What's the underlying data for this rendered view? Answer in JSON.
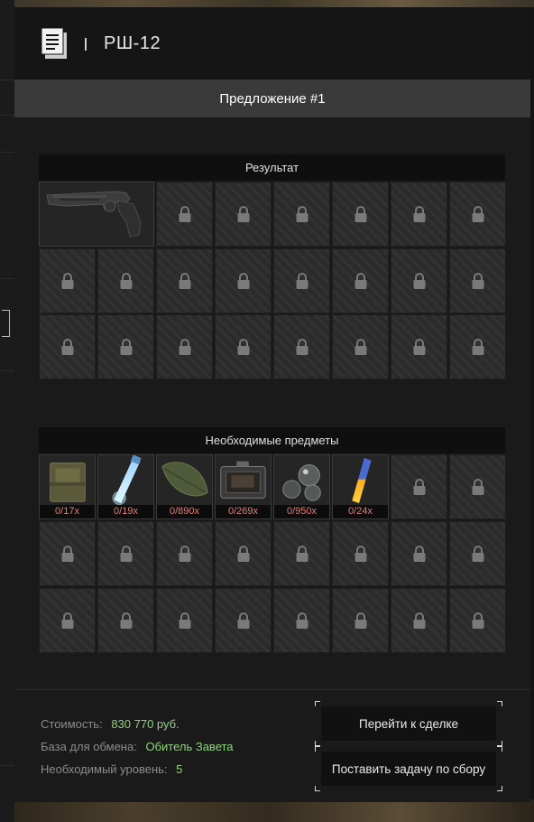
{
  "header": {
    "title": "РШ-12",
    "icon": "document-icon"
  },
  "offer": {
    "label": "Предложение #1"
  },
  "result": {
    "heading": "Результат",
    "item": {
      "name": "rsh-12-revolver",
      "icon": "revolver-icon"
    }
  },
  "required": {
    "heading": "Необходимые предметы",
    "items": [
      {
        "count": "0/17x",
        "icon": "ammo-box-icon"
      },
      {
        "count": "0/19x",
        "icon": "glowstick-blue-icon"
      },
      {
        "count": "0/890x",
        "icon": "leaf-icon"
      },
      {
        "count": "0/269x",
        "icon": "case-icon"
      },
      {
        "count": "0/950x",
        "icon": "spheres-icon"
      },
      {
        "count": "0/24x",
        "icon": "glowstick-orange-icon"
      }
    ]
  },
  "footer": {
    "cost_label": "Стоимость:",
    "cost_value": "830 770 руб.",
    "base_label": "База для обмена:",
    "base_value": "Обитель Завета",
    "level_label": "Необходимый уровень:",
    "level_value": "5"
  },
  "buttons": {
    "go_to_deal": "Перейти к сделке",
    "set_task": "Поставить задачу по сбору"
  },
  "colors": {
    "accent_value": "#8fd37c",
    "count_text": "#d9837b",
    "offer_bar": "#3a3a3a"
  }
}
